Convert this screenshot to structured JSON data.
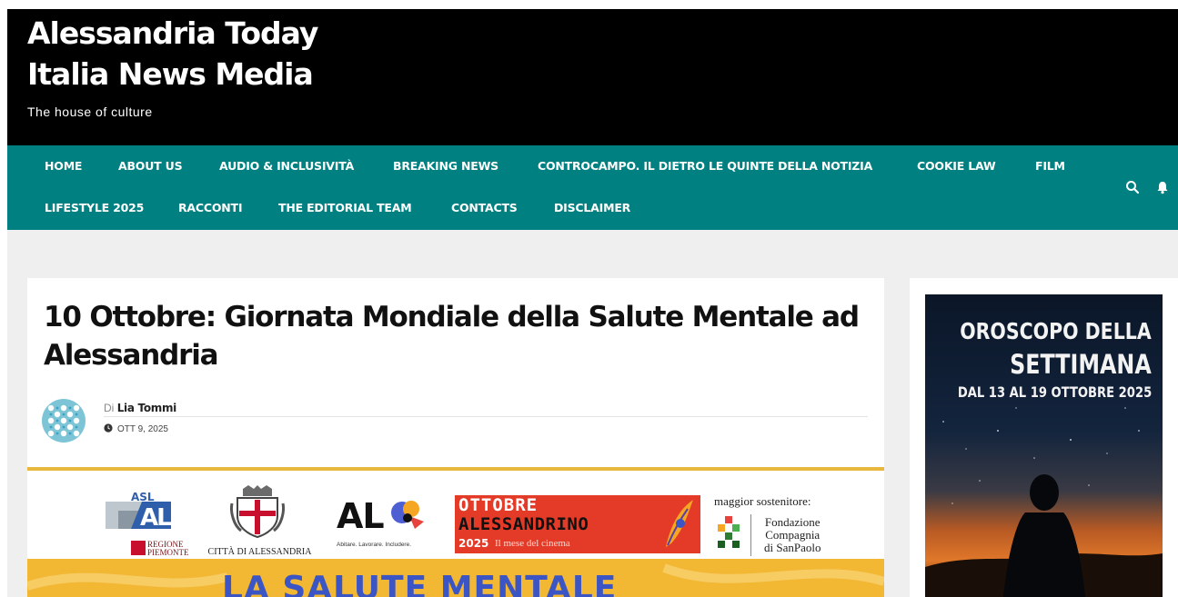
{
  "header": {
    "title_line1": "Alessandria Today",
    "title_line2": "Italia News Media",
    "tagline": "The house of culture"
  },
  "nav": {
    "row1": [
      "HOME",
      "ABOUT US",
      "AUDIO & INCLUSIVITÀ",
      "BREAKING NEWS",
      "CONTROCAMPO. IL DIETRO LE QUINTE DELLA NOTIZIA",
      "COOKIE LAW",
      "FILM"
    ],
    "row2": [
      "LIFESTYLE 2025",
      "RACCONTI",
      "THE EDITORIAL TEAM",
      "CONTACTS",
      "DISCLAIMER"
    ],
    "icons": [
      "search-icon",
      "bell-icon"
    ]
  },
  "article": {
    "title": "10 Ottobre:  Giornata Mondiale della Salute Mentale ad Alessandria",
    "by_prefix": "Di",
    "author": "Lia Tommi",
    "date": "OTT 9, 2025"
  },
  "banner": {
    "asl": "ASL",
    "asl_al": "AL",
    "regione_1": "REGIONE",
    "regione_2": "PIEMONTE",
    "citta": "CITTÀ DI ALESSANDRIA",
    "alt_logo": "AL",
    "alt_sub": "Abitare. Lavorare. Includere.",
    "ottobre_1": "OTTOBRE",
    "ottobre_2": "ALESSANDRINO",
    "ottobre_year": "2025",
    "ottobre_sub": "Il mese del cinema",
    "sponsor_label": "maggior sostenitore:",
    "fondazione_1": "Fondazione",
    "fondazione_2": "Compagnia",
    "fondazione_3": "di SanPaolo",
    "salute_text": "LA SALUTE MENTALE"
  },
  "sidebar_ad": {
    "line1": "OROSCOPO DELLA",
    "line2": "SETTIMANA",
    "line3": "DAL 13 AL 19 OTTOBRE 2025"
  },
  "colors": {
    "header_bg": "#000000",
    "nav_bg": "#008080",
    "content_bg": "#efefef",
    "banner_yellow": "#f2b733",
    "banner_blue": "#3b55c5",
    "ottobre_red": "#e43a28"
  }
}
